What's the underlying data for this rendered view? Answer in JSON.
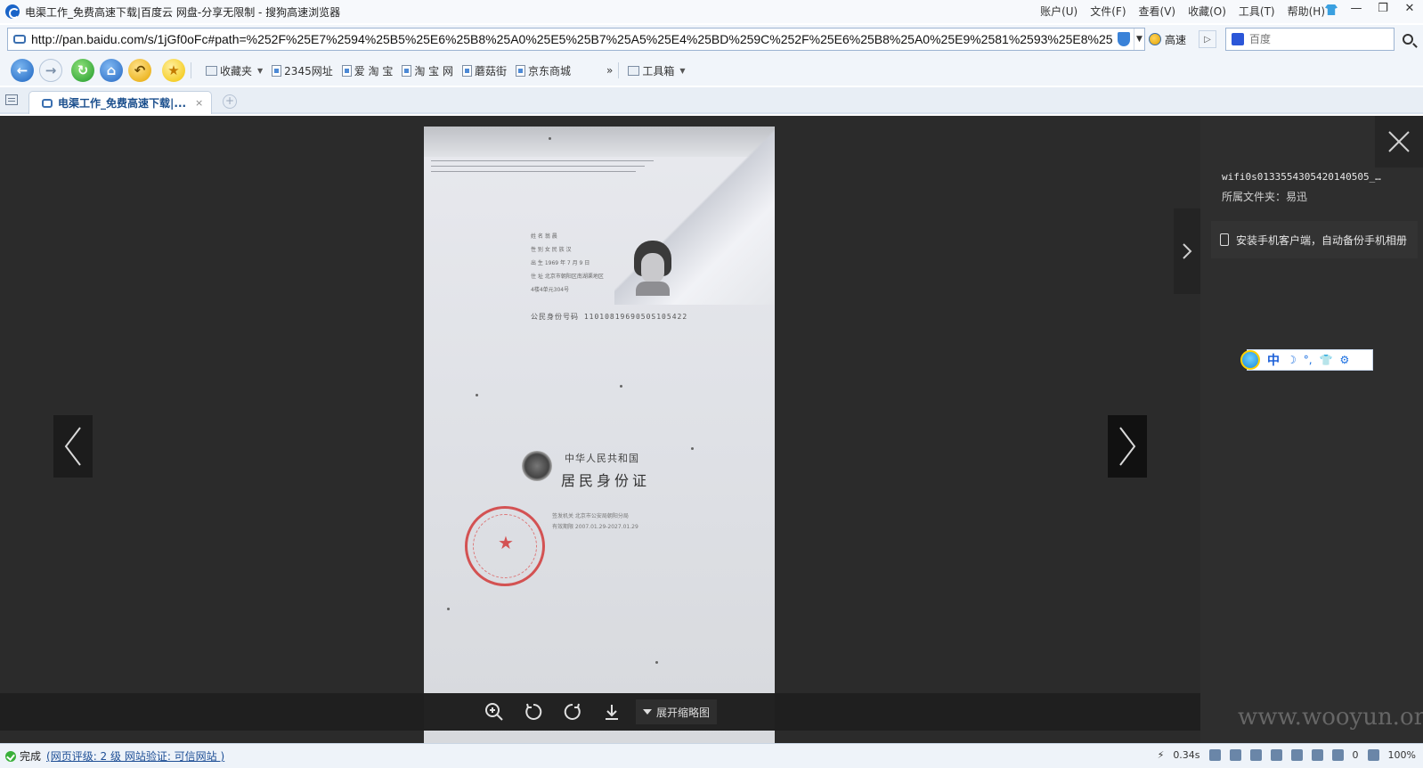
{
  "window": {
    "title": "电渠工作_免费高速下载|百度云 网盘-分享无限制 - 搜狗高速浏览器",
    "menu": [
      "账户(U)",
      "文件(F)",
      "查看(V)",
      "收藏(O)",
      "工具(T)",
      "帮助(H)"
    ]
  },
  "address_bar": {
    "url": "http://pan.baidu.com/s/1jGf0oFc#path=%252F%25E7%2594%25B5%25E6%25B8%25A0%25E5%25B7%25A5%25E4%25BD%259C%252F%25E6%25B8%25A0%25E9%2581%2593%25E8%25",
    "speed_label": "高速",
    "search_placeholder": "百度"
  },
  "toolbar": {
    "favorites_label": "收藏夹",
    "bookmarks": [
      "2345网址",
      "爱 淘 宝",
      "淘 宝 网",
      "蘑菇街",
      "京东商城"
    ],
    "more_label": "»",
    "toolbox_label": "工具箱"
  },
  "tabs": {
    "active_label": "电渠工作_免费高速下载|...",
    "close_glyph": "×",
    "new_tab_glyph": "+"
  },
  "viewer": {
    "document": {
      "id_front_rows": [
        "姓 名  翁 晨",
        "性 别 女  民 族 汉",
        "出 生 1969 年 7 月 9 日",
        "住 址 北京市朝阳区南湖渠地区",
        "4楼4单元304号"
      ],
      "id_number": "公民身份号码 1101081969050S105422",
      "country": "中华人民共和国",
      "card_name": "居民身份证",
      "issuer": "签发机关 北京市公安局朝阳分局",
      "validity": "有效期限 2007.01.29-2027.01.29"
    },
    "controls": {
      "expand_label": "展开缩略图"
    }
  },
  "side_panel": {
    "file_name": "wifi0s0133554305420140505_…",
    "folder_label": "所属文件夹：易迅",
    "promo_text": "安装手机客户端，自动备份手机相册"
  },
  "ime_bar": {
    "mode": "中",
    "symbols": [
      "☽",
      "°,",
      "👕",
      "⚙"
    ]
  },
  "status_bar": {
    "done": "完成",
    "rating": "(网页评级: 2 级 网站验证: 可信网站 )",
    "load_time": "0.34s",
    "counter": "0",
    "zoom": "100%"
  },
  "watermark": "www.wooyun.org"
}
